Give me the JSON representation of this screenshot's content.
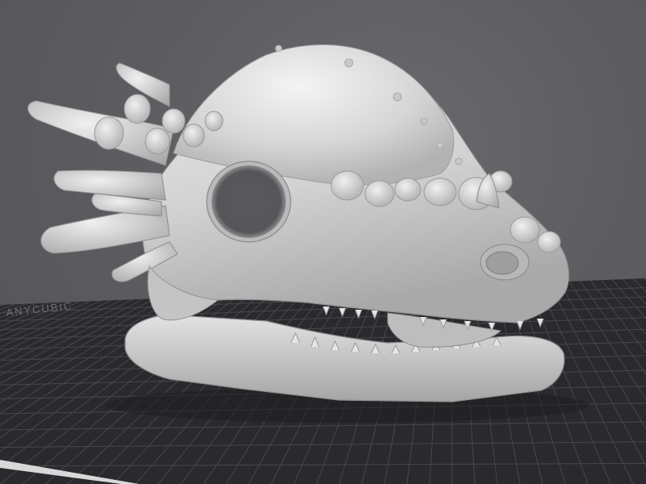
{
  "app": {
    "view": "3d-viewport"
  },
  "build_plate": {
    "logo_text": "ANYCUBIC",
    "grid": true,
    "colors": {
      "plate": "#2a2a2e",
      "grid_line": "#46464b",
      "edge": "#d8d8d8"
    }
  },
  "model": {
    "icon": "dinosaur-skull-model",
    "colors": {
      "surface": "#d6d6d6",
      "shadow": "#9a9a9a",
      "highlight": "#f2f2f2"
    }
  },
  "colors": {
    "background": "#5d5d61"
  }
}
